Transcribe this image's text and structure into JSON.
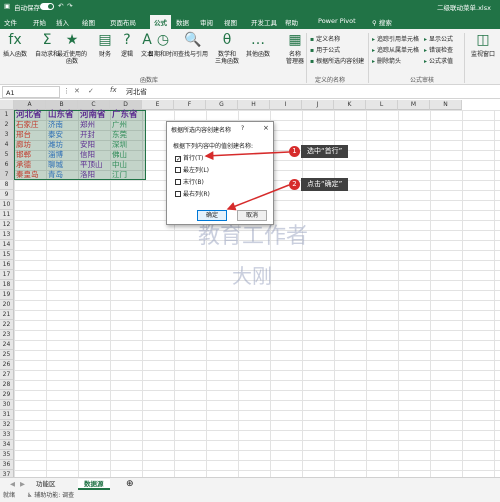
{
  "titlebar": {
    "autosave": "自动保存",
    "filename": "二级联动菜单.xlsx"
  },
  "tabs": [
    "文件",
    "开始",
    "插入",
    "绘图",
    "页面布局",
    "公式",
    "数据",
    "审阅",
    "视图",
    "开发工具",
    "帮助",
    "Power Pivot"
  ],
  "active_tab": "公式",
  "search_label": "搜索",
  "ribbon": {
    "big_buttons": [
      {
        "icon": "fx",
        "label": "插入函数"
      },
      {
        "icon": "Σ",
        "label": "自动求和"
      },
      {
        "icon": "★",
        "label": "最近使用的\n函数"
      },
      {
        "icon": "▤",
        "label": "财务"
      },
      {
        "icon": "?",
        "label": "逻辑"
      },
      {
        "icon": "A",
        "label": "文本"
      },
      {
        "icon": "◷",
        "label": "日期和时间"
      },
      {
        "icon": "🔍",
        "label": "查找与引用"
      },
      {
        "icon": "θ",
        "label": "数学和\n三角函数"
      },
      {
        "icon": "…",
        "label": "其他函数"
      },
      {
        "icon": "▦",
        "label": "名称\n管理器"
      }
    ],
    "name_group": [
      "定义名称",
      "用于公式",
      "根据所选内容创建"
    ],
    "audit_group_left": [
      "追踪引用单元格",
      "追踪从属单元格",
      "删除箭头"
    ],
    "audit_group_right": [
      "显示公式",
      "错误检查",
      "公式求值"
    ],
    "watch": "监视窗口",
    "group_labels": [
      "函数库",
      "定义的名称",
      "公式审核"
    ]
  },
  "formula_bar": {
    "name_box": "A1",
    "fx": "fx",
    "value": "河北省"
  },
  "columns": [
    "A",
    "B",
    "C",
    "D",
    "E",
    "F",
    "G",
    "H",
    "I",
    "J",
    "K",
    "L",
    "M",
    "N"
  ],
  "rows": 37,
  "table": {
    "headers": [
      "河北省",
      "山东省",
      "河南省",
      "广东省"
    ],
    "data": [
      [
        "石家庄",
        "济南",
        "郑州",
        "广州"
      ],
      [
        "邢台",
        "泰安",
        "开封",
        "东莞"
      ],
      [
        "廊坊",
        "潍坊",
        "安阳",
        "深圳"
      ],
      [
        "邯郸",
        "淄博",
        "信阳",
        "佛山"
      ],
      [
        "承德",
        "聊城",
        "平顶山",
        "中山"
      ],
      [
        "秦皇岛",
        "青岛",
        "洛阳",
        "江门"
      ]
    ]
  },
  "dialog": {
    "title": "根据所选内容创建名称",
    "help": "?",
    "close": "×",
    "prompt": "根据下列内容中的值创建名称:",
    "options": [
      {
        "label": "首行(T)",
        "checked": true
      },
      {
        "label": "最左列(L)",
        "checked": false
      },
      {
        "label": "末行(B)",
        "checked": false
      },
      {
        "label": "最右列(R)",
        "checked": false
      }
    ],
    "ok": "确定",
    "cancel": "取消"
  },
  "callouts": [
    {
      "num": "1",
      "text": "选中“首行”"
    },
    {
      "num": "2",
      "text": "点击“确定”"
    }
  ],
  "watermark": [
    "教育工作者",
    "大刚"
  ],
  "sheet_tabs": [
    "功能区",
    "数据源"
  ],
  "active_sheet": "数据源",
  "status": "就绪",
  "status_accessibility": "辅助功能: 调查",
  "colors": {
    "accent": "#217346",
    "header_text": "#5c2d91",
    "arrow": "#d62b2b"
  }
}
